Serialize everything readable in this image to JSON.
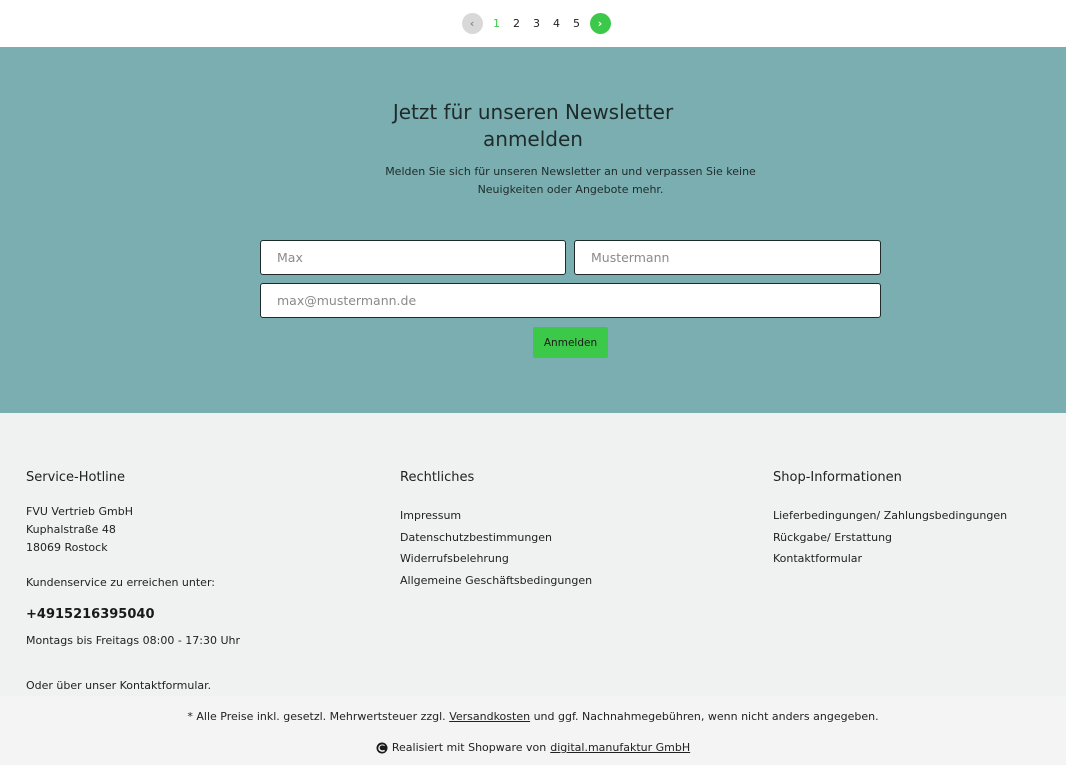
{
  "pagination": {
    "pages": [
      "1",
      "2",
      "3",
      "4",
      "5"
    ],
    "prev_glyph": "‹",
    "next_glyph": "›",
    "active_color": "#3cc94a"
  },
  "newsletter": {
    "title_line1": "Jetzt für unseren Newsletter",
    "title_line2": "anmelden",
    "description": "Melden Sie sich für unseren Newsletter an und verpassen Sie keine Neuigkeiten oder Angebote mehr.",
    "first_name_placeholder": "Max",
    "last_name_placeholder": "Mustermann",
    "email_placeholder": "max@mustermann.de",
    "submit_label": "Anmelden",
    "background_color": "#7aaeb0"
  },
  "footer": {
    "service": {
      "heading": "Service-Hotline",
      "company": "FVU Vertrieb GmbH",
      "street": "Kuphalstraße 48",
      "city": "18069 Rostock",
      "support_text": "Kundenservice zu erreichen unter:",
      "phone": "+4915216395040",
      "hours": "Montags bis Freitags 08:00 - 17:30 Uhr",
      "contact_text": "Oder über unser Kontaktformular."
    },
    "legal": {
      "heading": "Rechtliches",
      "links": [
        "Impressum",
        "Datenschutzbestimmungen",
        "Widerrufsbelehrung",
        "Allgemeine Geschäftsbedingungen"
      ]
    },
    "shop_info": {
      "heading": "Shop-Informationen",
      "links": [
        "Lieferbedingungen/ Zahlungsbedingungen",
        "Rückgabe/ Erstattung",
        "Kontaktformular"
      ]
    }
  },
  "bottom": {
    "vat_prefix": "* Alle Preise inkl. gesetzl. Mehrwertsteuer zzgl.",
    "vat_link": "Versandkosten",
    "vat_suffix": "und ggf. Nachnahmegebühren, wenn nicht anders angegeben.",
    "powered_prefix": "Realisiert mit Shopware von",
    "powered_link": "digital.manufaktur GmbH",
    "logo_icon": "shopware-logo-icon"
  }
}
